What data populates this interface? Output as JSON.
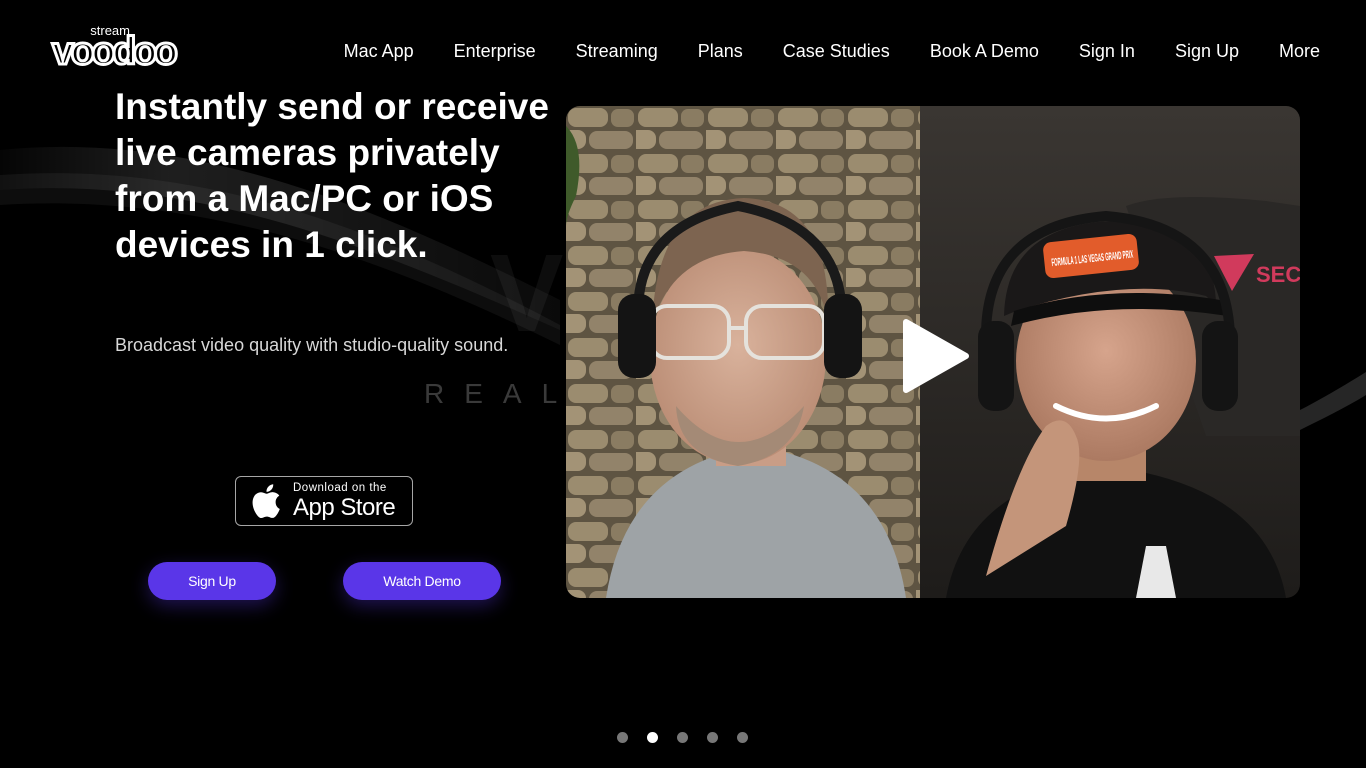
{
  "header": {
    "logo": {
      "top": "stream",
      "main": "voodoo"
    },
    "nav": [
      "Mac App",
      "Enterprise",
      "Streaming",
      "Plans",
      "Case Studies",
      "Book A Demo",
      "Sign In",
      "Sign Up",
      "More"
    ]
  },
  "background": {
    "ghost_text": "V",
    "tagline": "REAL"
  },
  "hero": {
    "headline": "Instantly send or receive live cameras privately from a Mac/PC or iOS devices in 1 click.",
    "subline": "Broadcast video quality with studio-quality sound.",
    "app_store": {
      "small": "Download on the",
      "big": "App Store"
    },
    "signup_label": "Sign Up",
    "demo_label": "Watch Demo"
  },
  "video": {
    "cap_text": "FORMULA 1 LAS VEGAS GRAND PRIX",
    "wall_logo_text": "SEC"
  },
  "carousel": {
    "count": 5,
    "active_index": 1
  },
  "colors": {
    "accent": "#5a36e8",
    "background": "#000000"
  }
}
